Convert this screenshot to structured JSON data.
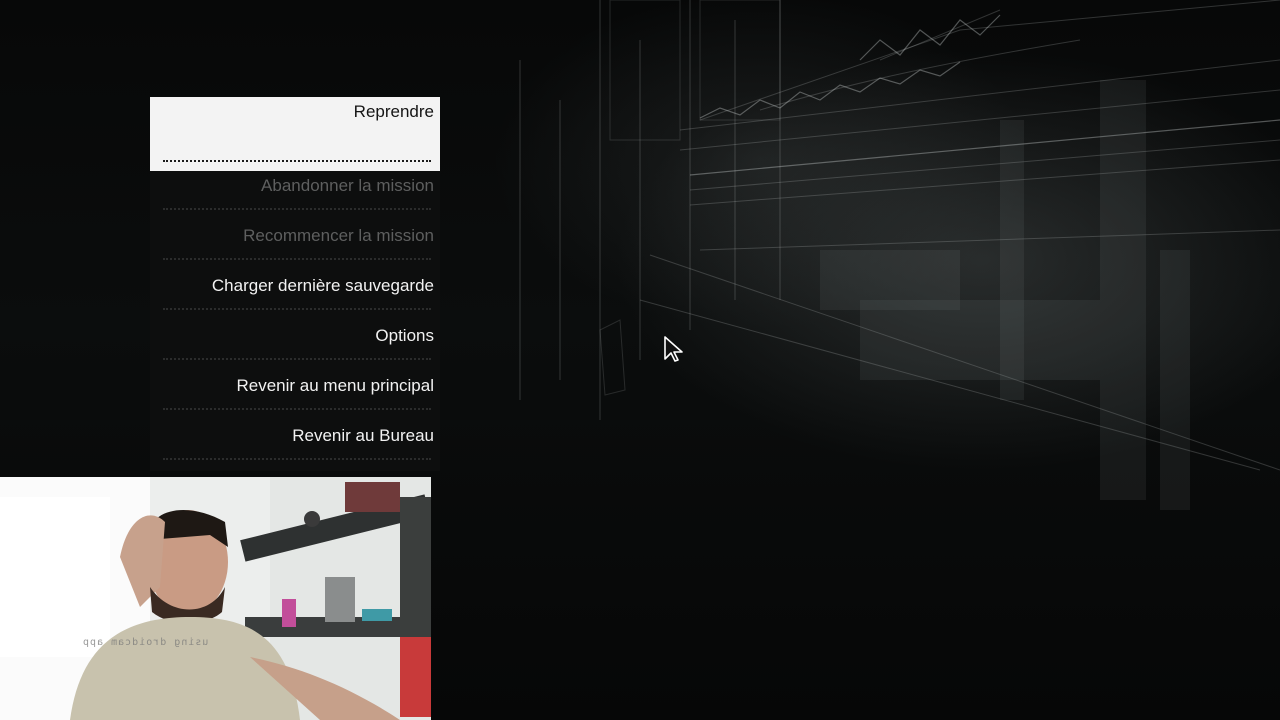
{
  "pause_menu": {
    "items": [
      {
        "label": "Reprendre",
        "state": "selected"
      },
      {
        "label": "Abandonner la mission",
        "state": "disabled"
      },
      {
        "label": "Recommencer la mission",
        "state": "disabled"
      },
      {
        "label": "Charger dernière sauvegarde",
        "state": "enabled"
      },
      {
        "label": "Options",
        "state": "enabled"
      },
      {
        "label": "Revenir au menu principal",
        "state": "enabled"
      },
      {
        "label": "Revenir au Bureau",
        "state": "enabled"
      }
    ]
  },
  "webcam": {
    "caption": "using droidcam app"
  },
  "colors": {
    "menu_text": "#f2f2f2",
    "menu_disabled_text": "#5e5f5f",
    "menu_selected_bg": "#f3f3f3",
    "menu_selected_text": "#151515",
    "background": "#040505"
  },
  "icons": {
    "cursor": "mouse-pointer-icon"
  }
}
